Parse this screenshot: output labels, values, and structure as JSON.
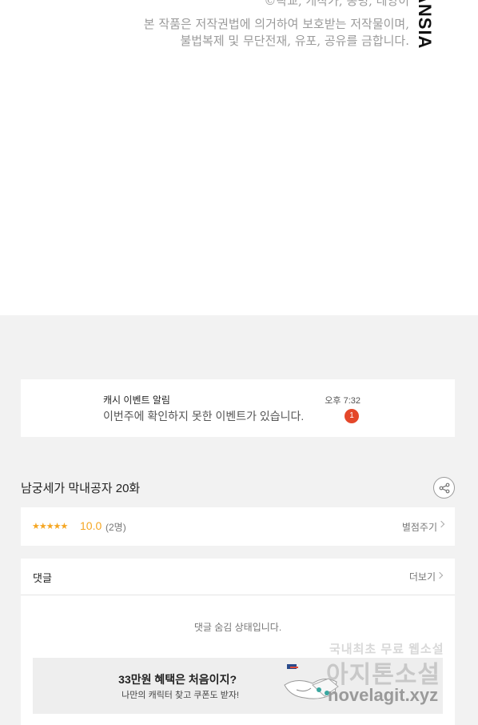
{
  "copyright": {
    "line1": "©락교, 개작가, 봉명, 테양이",
    "line2": "본 작품은 저작권법에 의거하여 보호받는 저작물이며,",
    "line3": "불법복제 및 무단전재, 유포, 공유를 금합니다."
  },
  "logo": {
    "text": "ANSIA"
  },
  "event": {
    "title": "캐시 이벤트 알림",
    "message": "이번주에 확인하지 못한 이벤트가 있습니다.",
    "time": "오후 7:32",
    "badge": "1"
  },
  "episode": {
    "title": "남궁세가 막내공자 20화"
  },
  "rating": {
    "stars": "★★★★★",
    "score": "10.0",
    "count": "(2명)",
    "rate_label": "별점주기"
  },
  "comments": {
    "label": "댓글",
    "more_label": "더보기",
    "hidden_message": "댓글 숨김 상태입니다."
  },
  "banner": {
    "title": "33만원 혜택은 처음이지?",
    "subtitle": "나만의 캐릭터 찾고 쿠폰도 받자!"
  },
  "watermark": {
    "line1": "국내최초 무료 웹소설",
    "line2": "아지톤소설",
    "line3": "novelagit.xyz"
  },
  "colors": {
    "accent": "#f5a623",
    "badge": "#e4472a",
    "page_bg": "#f2f2f2"
  }
}
